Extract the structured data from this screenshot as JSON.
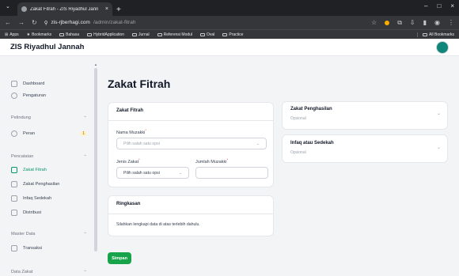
{
  "browser": {
    "tab_title": "Zakat Fitrah - ZIS Riyadhul Jann",
    "url_host": "zis-rjberhagi.com",
    "url_path": "/admin/zakat-fitrah",
    "bookmarks": [
      "Apps",
      "Bookmarks",
      "Bahasa",
      "HybridApplication",
      "Jurnal",
      "Referensi Modul",
      "Oval",
      "Practice"
    ],
    "all_bookmarks": "All Bookmarks"
  },
  "app": {
    "brand": "ZIS Riyadhul Jannah"
  },
  "sidebar": {
    "dashboard": "Dashboard",
    "pengaturan": "Pengaturan",
    "group_pelindung": "Pelindung",
    "peran": "Peran",
    "peran_badge": "1",
    "group_pencatatan": "Pencatatan",
    "zakat_fitrah": "Zakat Fitrah",
    "zakat_penghasilan": "Zakat Penghasilan",
    "infaq_sedekah": "Infaq Sedekah",
    "distribusi": "Distribusi",
    "group_master": "Master Data",
    "transaksi": "Transaksi",
    "group_data_zakat": "Data Zakat"
  },
  "main": {
    "title": "Zakat Fitrah",
    "form_card_title": "Zakat Fitrah",
    "nama_muzakki_label": "Nama Muzakki",
    "nama_muzakki_placeholder": "Pilih salah satu opsi",
    "jenis_zakat_label": "Jenis Zakat",
    "jenis_zakat_placeholder": "Pilih salah satu opsi",
    "jumlah_muzakki_label": "Jumlah Muzakki",
    "jumlah_muzakki_value": "",
    "summary_title": "Ringkasan",
    "summary_text": "Silahkan lengkapi data di atas terlebih dahulu.",
    "save_button": "Simpan",
    "panel1_title": "Zakat Penghasilan",
    "panel1_sub": "Opsional",
    "panel2_title": "Infaq atau Sedekah",
    "panel2_sub": "Opsional"
  },
  "colors": {
    "accent": "#16a34a",
    "active_nav": "#059669",
    "avatar": "#10857a"
  }
}
